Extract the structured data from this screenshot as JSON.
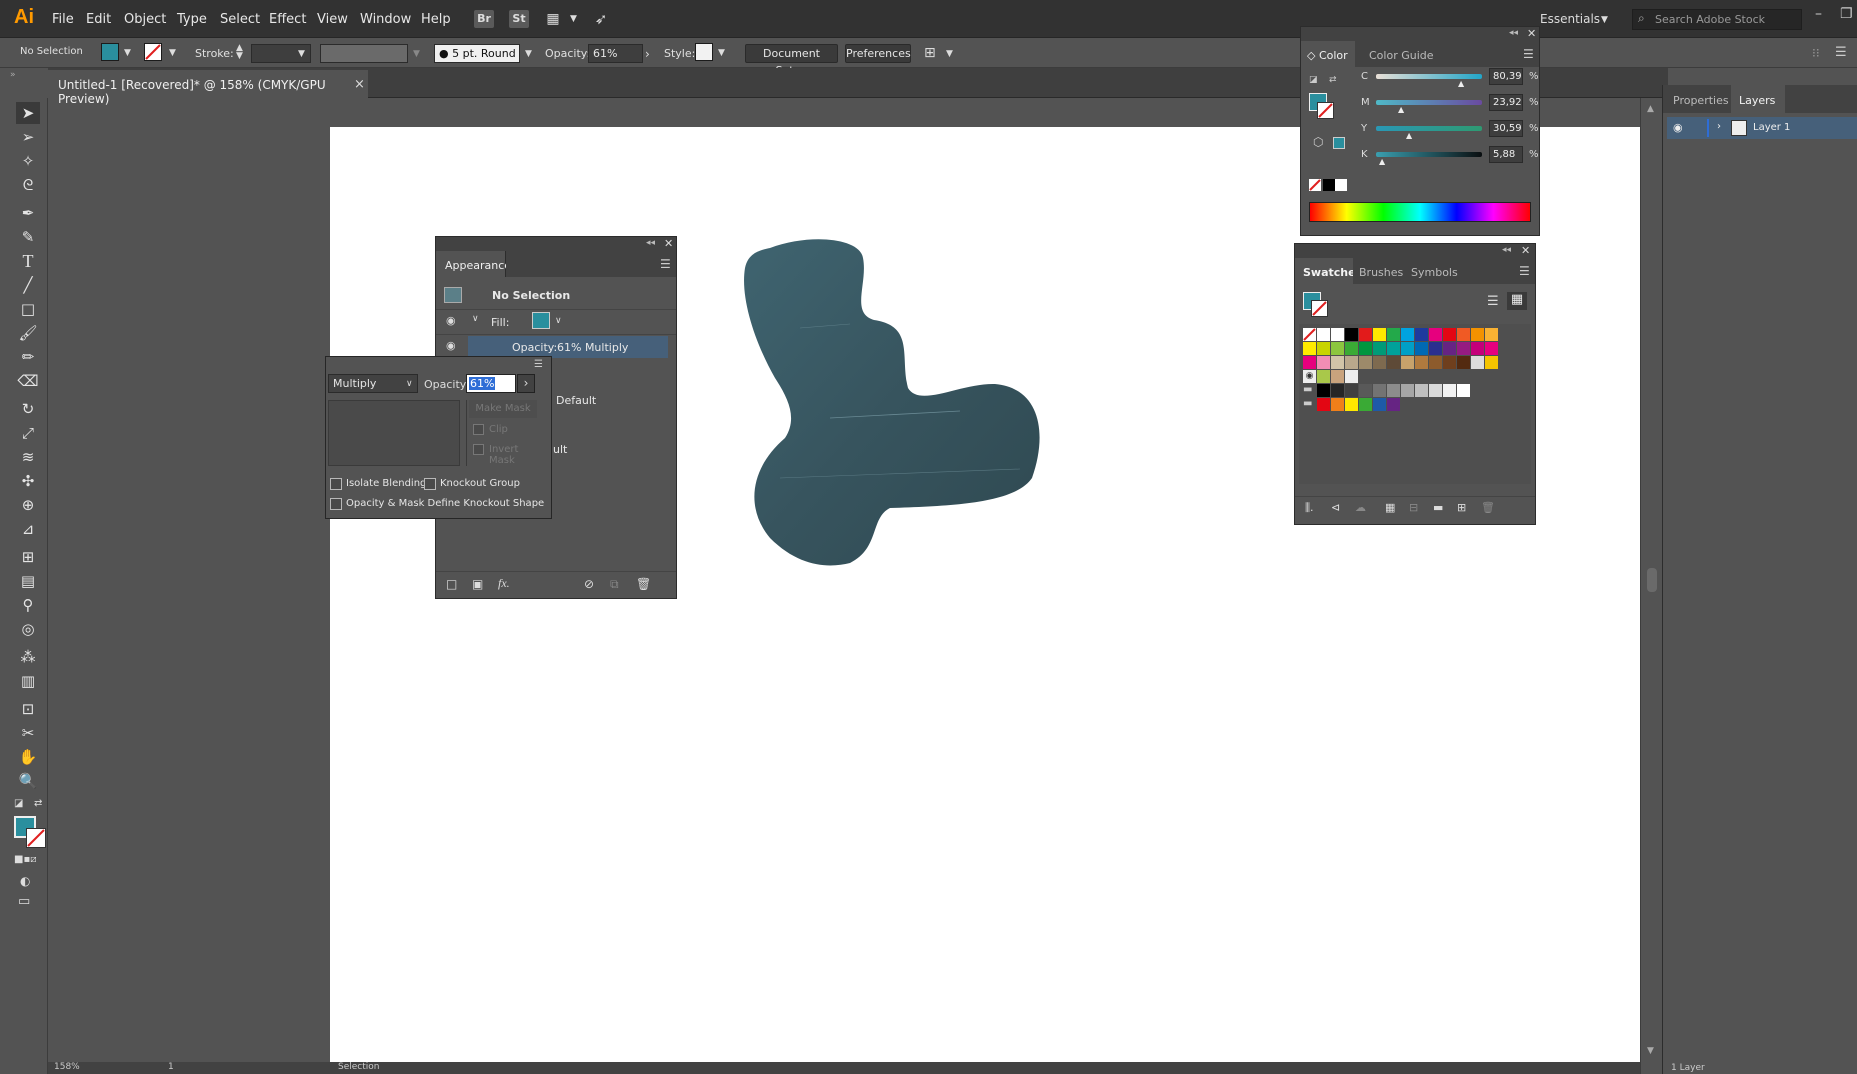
{
  "app": {
    "logo": "Ai"
  },
  "menu": [
    "File",
    "Edit",
    "Object",
    "Type",
    "Select",
    "Effect",
    "View",
    "Window",
    "Help"
  ],
  "menubar_icons": [
    {
      "label": "Br"
    },
    {
      "label": "St"
    }
  ],
  "workspace": {
    "label": "Essentials",
    "search_placeholder": "Search Adobe Stock"
  },
  "control": {
    "selection": "No Selection",
    "stroke_label": "Stroke:",
    "brush": "5 pt. Round",
    "opacity_label": "Opacity:",
    "opacity_value": "61%",
    "style_label": "Style:",
    "document_setup": "Document Setup",
    "preferences": "Preferences"
  },
  "document": {
    "tab_title": "Untitled-1 [Recovered]* @ 158% (CMYK/GPU Preview)",
    "close": "×"
  },
  "colors": {
    "fill": "#2a8f9e",
    "stroke_none": "#ffffff",
    "blob": "#3e5c66"
  },
  "appearance": {
    "title": "Appearance",
    "no_selection": "No Selection",
    "fill_label": "Fill:",
    "opacity_label": "Opacity:",
    "opacity_value": "61% Multiply",
    "default_label": "Default",
    "ult_label": "ult"
  },
  "transparency": {
    "blend_mode": "Multiply",
    "opacity_label": "Opacity:",
    "opacity_value": "61%",
    "make_mask": "Make Mask",
    "clip": "Clip",
    "invert_mask": "Invert Mask",
    "isolate_blending": "Isolate Blending",
    "knockout_group": "Knockout Group",
    "opacity_mask_knockout": "Opacity & Mask Define Knockout Shape"
  },
  "color_panel": {
    "tabs": [
      "Color",
      "Color Guide"
    ],
    "channels": [
      {
        "label": "C",
        "value": "80,39",
        "pct": "%",
        "fraction": 0.8
      },
      {
        "label": "M",
        "value": "23,92",
        "pct": "%",
        "fraction": 0.24
      },
      {
        "label": "Y",
        "value": "30,59",
        "pct": "%",
        "fraction": 0.31
      },
      {
        "label": "K",
        "value": "5,88",
        "pct": "%",
        "fraction": 0.06
      }
    ]
  },
  "swatches_panel": {
    "tabs": [
      "Swatches",
      "Brushes",
      "Symbols"
    ]
  },
  "layers_panel": {
    "tabs": [
      "Properties",
      "Layers"
    ],
    "layer_name": "Layer 1"
  },
  "statusbar": {
    "zoom": "158%",
    "page": "1",
    "tool": "Selection",
    "layer_count": "1 Layer"
  }
}
